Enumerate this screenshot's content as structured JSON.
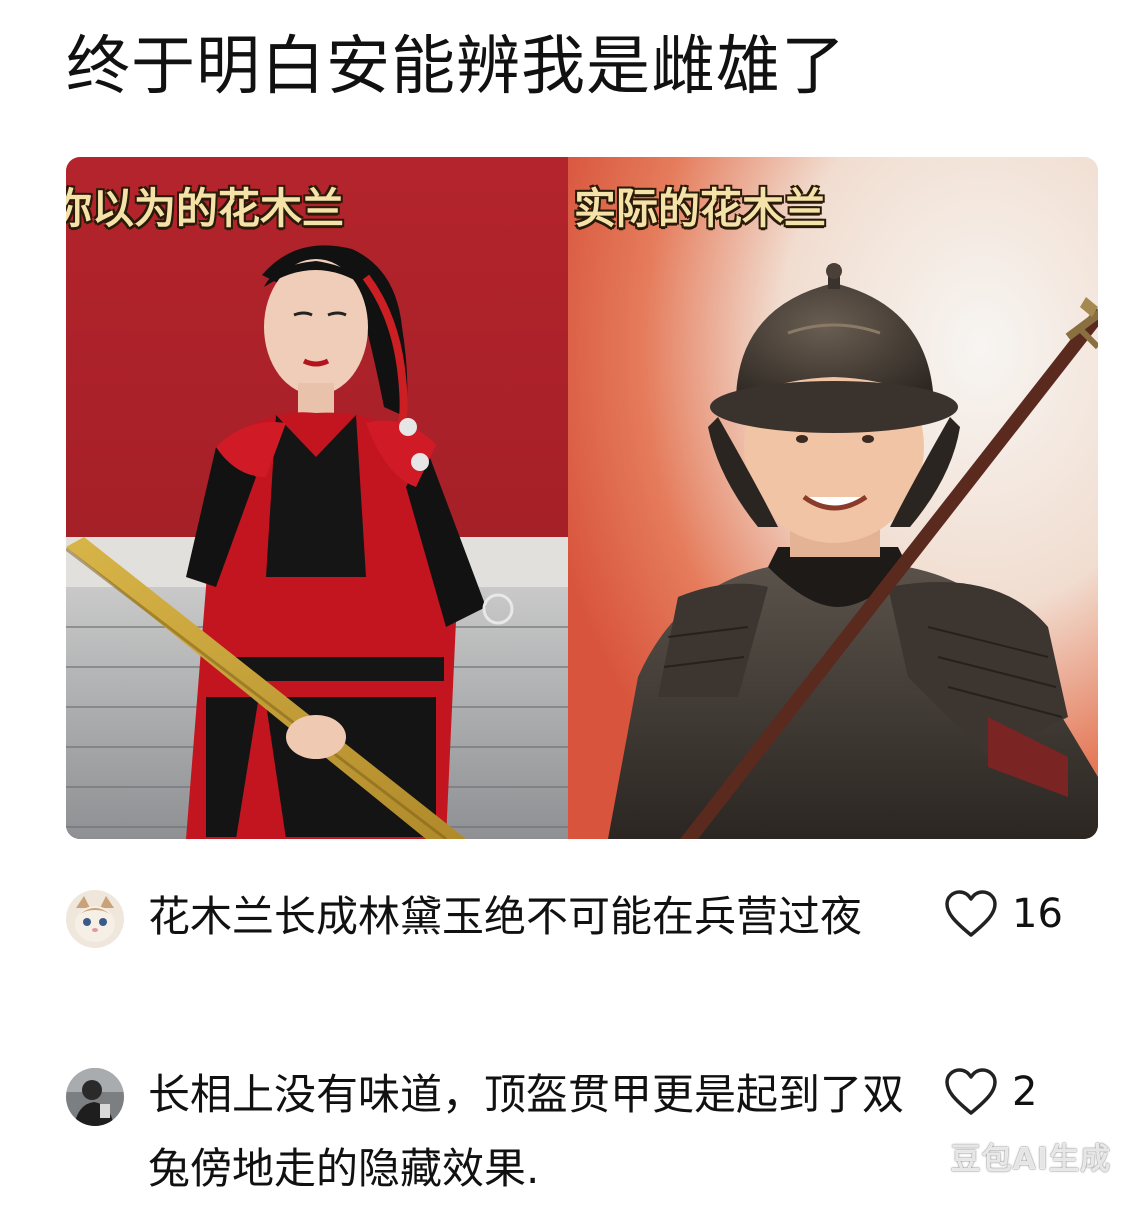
{
  "post": {
    "title": "终于明白安能辨我是雌雄了"
  },
  "media": {
    "left_caption": "你以为的花木兰",
    "right_caption": "实际的花木兰"
  },
  "comments": [
    {
      "text": "花木兰长成林黛玉绝不可能在兵营过夜",
      "likes": "16",
      "avatar_icon": "cat-avatar"
    },
    {
      "text": "长相上没有味道，顶盔贯甲更是起到了双兔傍地走的隐藏效果.",
      "likes": "2",
      "avatar_icon": "person-avatar"
    }
  ],
  "watermark": "豆包AI生成"
}
